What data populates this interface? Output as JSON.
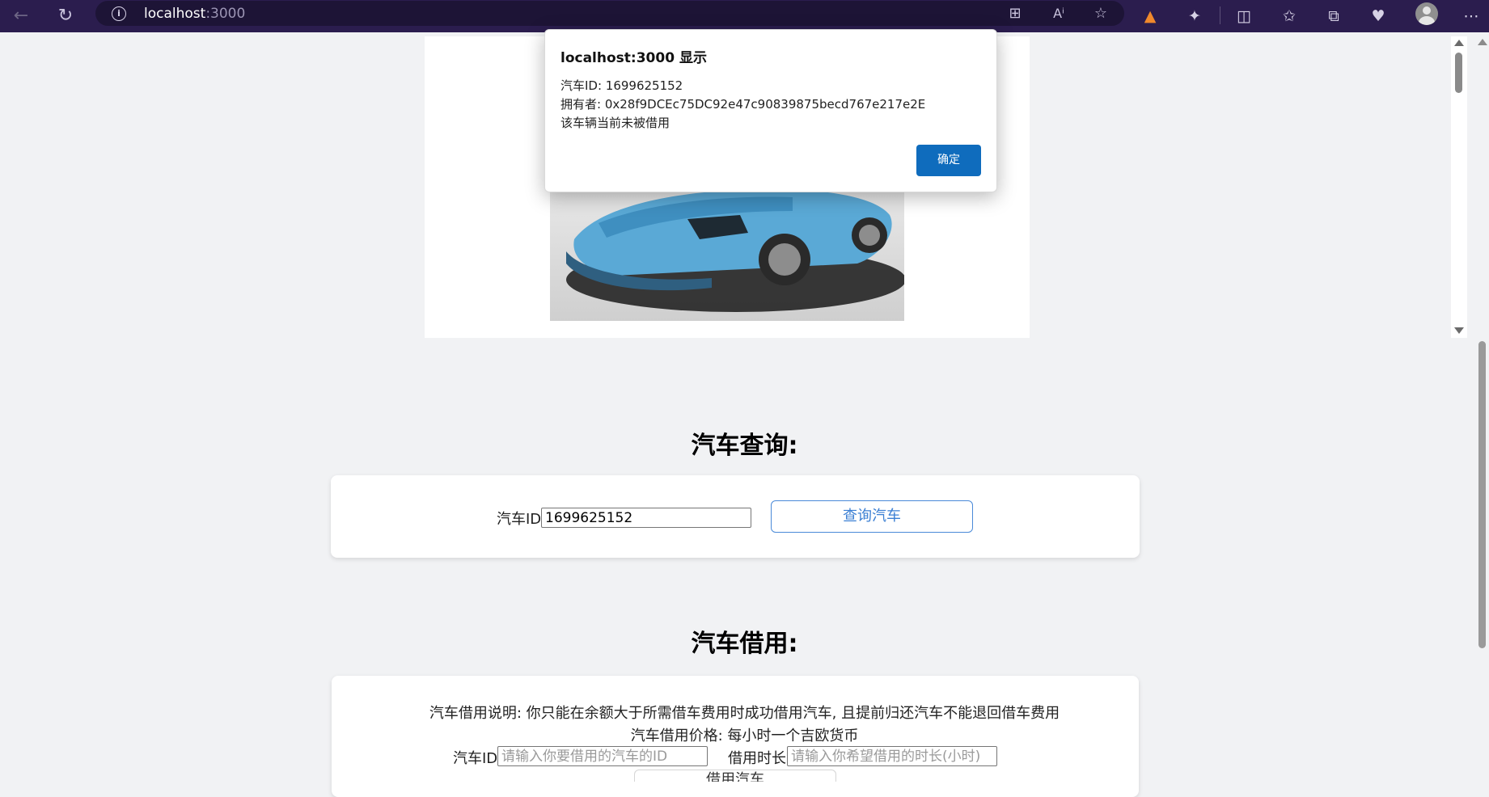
{
  "browser": {
    "url_host": "localhost",
    "url_port": ":3000"
  },
  "dialog": {
    "title": "localhost:3000 显示",
    "lines": [
      "汽车ID: 1699625152",
      "拥有者: 0x28f9DCEc75DC92e47c90839875becd767e217e2E",
      "该车辆当前未被借用"
    ],
    "ok_label": "确定"
  },
  "query": {
    "heading": "汽车查询:",
    "id_label": "汽车ID:",
    "id_value": "1699625152",
    "button_label": "查询汽车"
  },
  "borrow": {
    "heading": "汽车借用:",
    "description": "汽车借用说明: 你只能在余额大于所需借车费用时成功借用汽车, 且提前归还汽车不能退回借车费用",
    "price": "汽车借用价格: 每小时一个吉欧货币",
    "id_label": "汽车ID:",
    "id_placeholder": "请输入你要借用的汽车的ID",
    "duration_label": "借用时长:",
    "duration_placeholder": "请输入你希望借用的时长(小时)",
    "button_label": "借用汽车"
  },
  "icons": {
    "back": "back-arrow-icon",
    "refresh": "refresh-icon",
    "info": "site-info-icon",
    "apps": "app-grid-icon",
    "read_aloud": "read-aloud-icon",
    "favorite": "star-icon",
    "metamask": "metamask-fox-icon",
    "extensions": "puzzle-icon",
    "split": "split-screen-icon",
    "favorites": "favorites-icon",
    "collections": "collections-icon",
    "performance": "heartbeat-icon",
    "profile": "avatar",
    "menu": "more-menu-icon"
  }
}
